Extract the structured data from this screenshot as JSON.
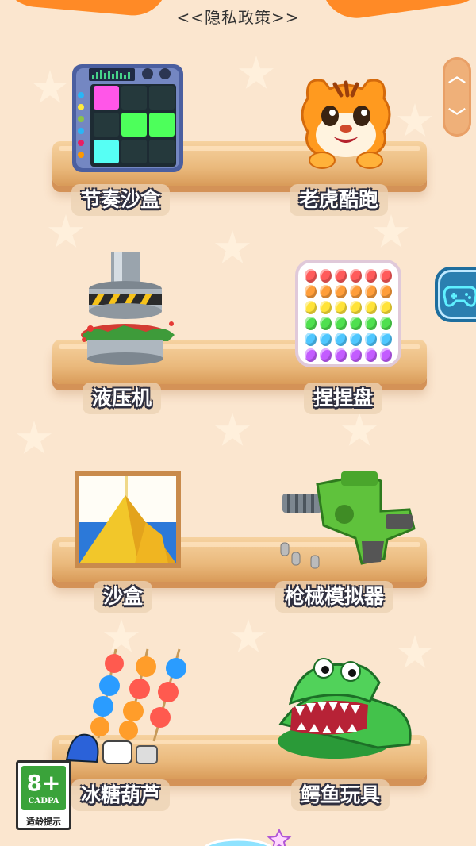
{
  "header": {
    "privacy_link": "<<隐私政策>>"
  },
  "scroll_tab": {
    "up_icon": "chevron-up-icon",
    "down_icon": "chevron-down-icon"
  },
  "side_button": {
    "icon": "gamepad-icon"
  },
  "games": [
    {
      "label": "节奏沙盒",
      "icon": "rhythm-pad-icon"
    },
    {
      "label": "老虎酷跑",
      "icon": "tiger-icon"
    },
    {
      "label": "液压机",
      "icon": "hydraulic-press-icon"
    },
    {
      "label": "捏捏盘",
      "icon": "pop-it-icon"
    },
    {
      "label": "沙盒",
      "icon": "sand-pyramid-icon"
    },
    {
      "label": "枪械模拟器",
      "icon": "toy-gun-icon"
    },
    {
      "label": "冰糖葫芦",
      "icon": "candied-fruit-skewers-icon"
    },
    {
      "label": "鳄鱼玩具",
      "icon": "crocodile-dentist-icon"
    }
  ],
  "age_rating": {
    "number": "8+",
    "org": "CADPA",
    "desc": "适龄提示"
  },
  "colors": {
    "background": "#fbe6cf",
    "shelf": "#eab97c",
    "accent": "#ff8a26",
    "label_outline": "#2f2f3f"
  }
}
